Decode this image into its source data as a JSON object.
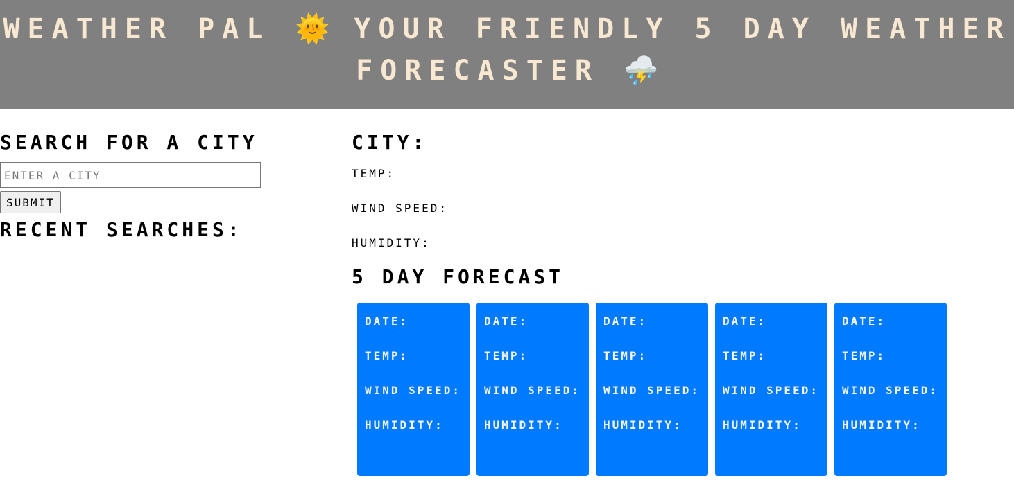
{
  "header": {
    "line1": "Weather Pal",
    "emoji_sun": "🌞",
    "line1_rest": "Your Friendly 5 Day Weather",
    "line2": "Forecaster",
    "emoji_storm": "⛈️"
  },
  "sidebar": {
    "search_title": "Search for a City",
    "input_placeholder": "Enter a City",
    "input_value": "",
    "submit_label": "Submit",
    "recent_title": "Recent Searches:"
  },
  "current": {
    "city_label": "City:",
    "temp_label": "Temp:",
    "wind_label": "Wind Speed:",
    "humidity_label": "Humidity:"
  },
  "forecast": {
    "title": "5 Day Forecast",
    "cards": [
      {
        "date_label": "Date:",
        "temp_label": "Temp:",
        "wind_label": "Wind Speed:",
        "humidity_label": "Humidity:"
      },
      {
        "date_label": "Date:",
        "temp_label": "Temp:",
        "wind_label": "Wind Speed:",
        "humidity_label": "Humidity:"
      },
      {
        "date_label": "Date:",
        "temp_label": "Temp:",
        "wind_label": "Wind Speed:",
        "humidity_label": "Humidity:"
      },
      {
        "date_label": "Date:",
        "temp_label": "Temp:",
        "wind_label": "Wind Speed:",
        "humidity_label": "Humidity:"
      },
      {
        "date_label": "Date:",
        "temp_label": "Temp:",
        "wind_label": "Wind Speed:",
        "humidity_label": "Humidity:"
      }
    ]
  },
  "colors": {
    "header_bg": "#808080",
    "header_text": "#f8e8d2",
    "card_bg": "#007bff",
    "card_text": "#f3f3f3"
  }
}
